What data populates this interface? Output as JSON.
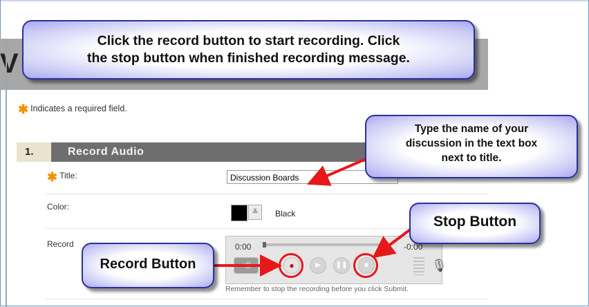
{
  "callouts": {
    "main_line1": "Click the record button to start recording.  Click",
    "main_line2": "the stop button when finished recording message.",
    "type_name_line1": "Type the name of your",
    "type_name_line2": "discussion in the text box",
    "type_name_line3": "next to title.",
    "stop": "Stop Button",
    "record": "Record Button"
  },
  "page": {
    "heading_initial": "V",
    "required_note": "Indicates a required field."
  },
  "step": {
    "number": "1.",
    "title": "Record Audio"
  },
  "form": {
    "title_label": "Title:",
    "title_value": "Discussion Boards",
    "color_label": "Color:",
    "color_value": "Black",
    "color_hex": "#000000",
    "record_label": "Record"
  },
  "recorder": {
    "time_start": "0:00",
    "time_end": "-0:00",
    "progress": 0,
    "buttons": [
      "volume-icon",
      "record-icon",
      "play-icon",
      "pause-icon",
      "stop-icon"
    ],
    "reminder": "Remember to stop the recording before you click Submit."
  },
  "colors": {
    "callout_border": "#2a2f9c",
    "arrow": "#e8171a",
    "required_star": "#f29100",
    "step_bar": "#6e6e6e"
  }
}
